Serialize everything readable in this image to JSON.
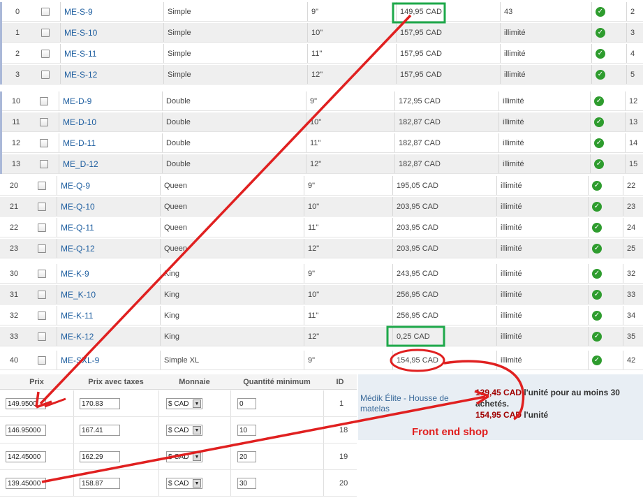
{
  "product_rows": [
    {
      "id": "0",
      "sku": "ME-S-9",
      "type": "Simple",
      "size": "9\"",
      "price": "149,95 CAD",
      "stock": "43",
      "last": "2"
    },
    {
      "id": "1",
      "sku": "ME-S-10",
      "type": "Simple",
      "size": "10\"",
      "price": "157,95 CAD",
      "stock": "illimité",
      "last": "3"
    },
    {
      "id": "2",
      "sku": "ME-S-11",
      "type": "Simple",
      "size": "11\"",
      "price": "157,95 CAD",
      "stock": "illimité",
      "last": "4"
    },
    {
      "id": "3",
      "sku": "ME-S-12",
      "type": "Simple",
      "size": "12\"",
      "price": "157,95 CAD",
      "stock": "illimité",
      "last": "5"
    },
    {
      "id": "10",
      "sku": "ME-D-9",
      "type": "Double",
      "size": "9\"",
      "price": "172,95 CAD",
      "stock": "illimité",
      "last": "12"
    },
    {
      "id": "11",
      "sku": "ME-D-10",
      "type": "Double",
      "size": "10\"",
      "price": "182,87 CAD",
      "stock": "illimité",
      "last": "13"
    },
    {
      "id": "12",
      "sku": "ME-D-11",
      "type": "Double",
      "size": "11\"",
      "price": "182,87 CAD",
      "stock": "illimité",
      "last": "14"
    },
    {
      "id": "13",
      "sku": "ME_D-12",
      "type": "Double",
      "size": "12\"",
      "price": "182,87 CAD",
      "stock": "illimité",
      "last": "15"
    },
    {
      "id": "20",
      "sku": "ME-Q-9",
      "type": "Queen",
      "size": "9\"",
      "price": "195,05 CAD",
      "stock": "illimité",
      "last": "22"
    },
    {
      "id": "21",
      "sku": "ME-Q-10",
      "type": "Queen",
      "size": "10\"",
      "price": "203,95 CAD",
      "stock": "illimité",
      "last": "23"
    },
    {
      "id": "22",
      "sku": "ME-Q-11",
      "type": "Queen",
      "size": "11\"",
      "price": "203,95 CAD",
      "stock": "illimité",
      "last": "24"
    },
    {
      "id": "23",
      "sku": "ME-Q-12",
      "type": "Queen",
      "size": "12\"",
      "price": "203,95 CAD",
      "stock": "illimité",
      "last": "25"
    },
    {
      "id": "30",
      "sku": "ME-K-9",
      "type": "King",
      "size": "9\"",
      "price": "243,95 CAD",
      "stock": "illimité",
      "last": "32"
    },
    {
      "id": "31",
      "sku": "ME_K-10",
      "type": "King",
      "size": "10\"",
      "price": "256,95 CAD",
      "stock": "illimité",
      "last": "33"
    },
    {
      "id": "32",
      "sku": "ME-K-11",
      "type": "King",
      "size": "11\"",
      "price": "256,95 CAD",
      "stock": "illimité",
      "last": "34"
    },
    {
      "id": "33",
      "sku": "ME-K-12",
      "type": "King",
      "size": "12\"",
      "price": "0,25 CAD",
      "stock": "illimité",
      "last": "35"
    },
    {
      "id": "40",
      "sku": "ME-SXL-9",
      "type": "Simple XL",
      "size": "9\"",
      "price": "154,95 CAD",
      "stock": "illimité",
      "last": "42"
    }
  ],
  "price_table": {
    "headers": {
      "prix": "Prix",
      "prix_taxes": "Prix avec taxes",
      "monnaie": "Monnaie",
      "qte_min": "Quantité minimum",
      "id": "ID"
    },
    "rows": [
      {
        "prix": "149.9500",
        "prix_taxes": "170.83",
        "monnaie": "$ CAD",
        "qte": "0",
        "id": "1"
      },
      {
        "prix": "146.95000",
        "prix_taxes": "167.41",
        "monnaie": "$ CAD",
        "qte": "10",
        "id": "18"
      },
      {
        "prix": "142.45000",
        "prix_taxes": "162.29",
        "monnaie": "$ CAD",
        "qte": "20",
        "id": "19"
      },
      {
        "prix": "139.45000",
        "prix_taxes": "158.87",
        "monnaie": "$ CAD",
        "qte": "30",
        "id": "20"
      }
    ]
  },
  "shop": {
    "product_name": "Médik Élite - Housse de matelas",
    "tier_price": "139,45 CAD",
    "tier_text": " l'unité pour au moins 30 achetés.",
    "base_price": "154,95 CAD",
    "base_text": " l'unité"
  },
  "annotation_label": "Front end shop",
  "colors": {
    "highlight_box": "#1ea84a",
    "annotation": "#e02020",
    "check": "#2e9c2e",
    "link": "#1f5fa0"
  }
}
